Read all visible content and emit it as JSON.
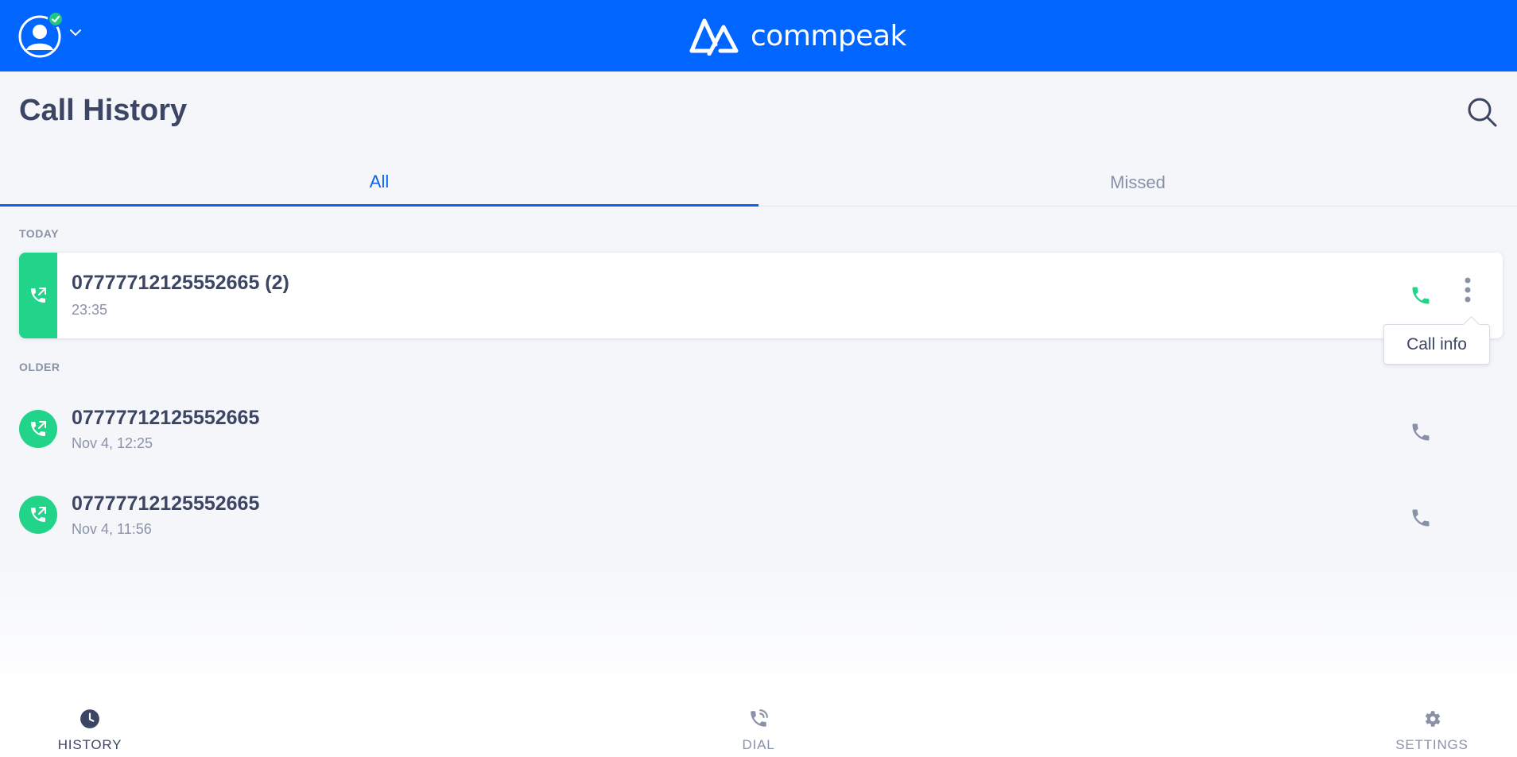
{
  "header": {
    "brand_name": "commpeak",
    "status": "online"
  },
  "page": {
    "title": "Call History"
  },
  "tabs": [
    {
      "label": "All",
      "active": true
    },
    {
      "label": "Missed",
      "active": false
    }
  ],
  "sections": {
    "today": "TODAY",
    "older": "OLDER"
  },
  "calls": {
    "today": [
      {
        "number": "07777712125552665 (2)",
        "time": "23:35",
        "type": "outgoing"
      }
    ],
    "older": [
      {
        "number": "07777712125552665",
        "time": "Nov 4, 12:25",
        "type": "outgoing"
      },
      {
        "number": "07777712125552665",
        "time": "Nov 4, 11:56",
        "type": "outgoing"
      }
    ]
  },
  "tooltip": {
    "text": "Call info"
  },
  "bottom_nav": [
    {
      "label": "HISTORY",
      "icon": "clock-icon",
      "active": true
    },
    {
      "label": "DIAL",
      "icon": "phone-dial-icon",
      "active": false
    },
    {
      "label": "SETTINGS",
      "icon": "gear-icon",
      "active": false
    }
  ],
  "colors": {
    "header": "#0066ff",
    "accent": "#0a63e8",
    "call_green": "#22d38a",
    "text": "#3c4564",
    "muted": "#8a92a8"
  }
}
